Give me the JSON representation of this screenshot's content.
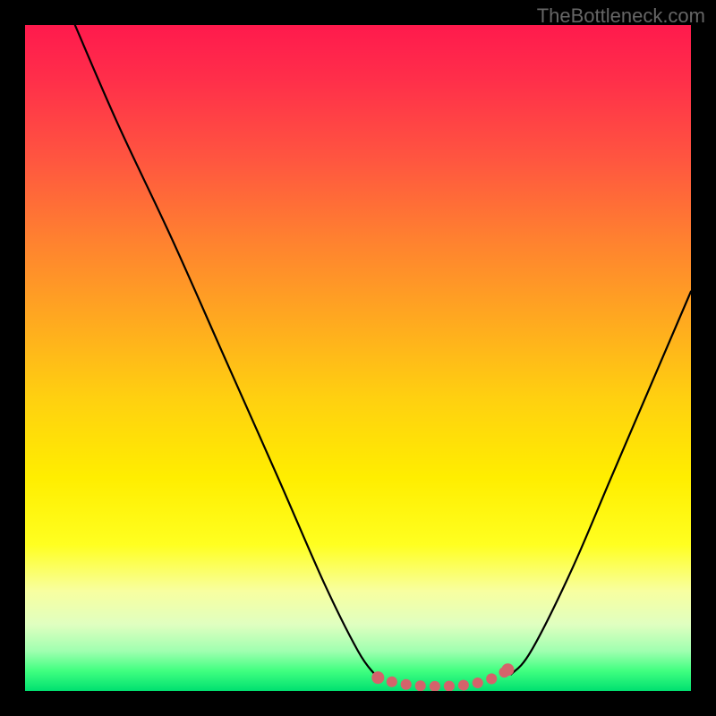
{
  "watermark": "TheBottleneck.com",
  "chart_data": {
    "type": "line",
    "title": "",
    "xlabel": "",
    "ylabel": "",
    "xlim": [
      0,
      100
    ],
    "ylim": [
      0,
      100
    ],
    "gradient_stops": [
      {
        "pos": 0,
        "color": "#ff1a4d"
      },
      {
        "pos": 8,
        "color": "#ff2e4a"
      },
      {
        "pos": 20,
        "color": "#ff5540"
      },
      {
        "pos": 32,
        "color": "#ff8030"
      },
      {
        "pos": 44,
        "color": "#ffa820"
      },
      {
        "pos": 56,
        "color": "#ffd010"
      },
      {
        "pos": 68,
        "color": "#ffee00"
      },
      {
        "pos": 78,
        "color": "#ffff20"
      },
      {
        "pos": 85,
        "color": "#f8ffa0"
      },
      {
        "pos": 90,
        "color": "#e0ffc0"
      },
      {
        "pos": 94,
        "color": "#a0ffb0"
      },
      {
        "pos": 97,
        "color": "#40ff80"
      },
      {
        "pos": 100,
        "color": "#00e070"
      }
    ],
    "series": [
      {
        "name": "left-curve",
        "type": "smooth-line",
        "color": "#000000",
        "stroke_width": 2.2,
        "points": [
          {
            "x": 7.5,
            "y": 100
          },
          {
            "x": 14,
            "y": 85
          },
          {
            "x": 22,
            "y": 68
          },
          {
            "x": 30,
            "y": 50
          },
          {
            "x": 38,
            "y": 32
          },
          {
            "x": 45,
            "y": 16
          },
          {
            "x": 50,
            "y": 6
          },
          {
            "x": 52.5,
            "y": 2.5
          }
        ]
      },
      {
        "name": "right-curve",
        "type": "smooth-line",
        "color": "#000000",
        "stroke_width": 2.2,
        "points": [
          {
            "x": 73,
            "y": 2.5
          },
          {
            "x": 76,
            "y": 6
          },
          {
            "x": 82,
            "y": 18
          },
          {
            "x": 88,
            "y": 32
          },
          {
            "x": 94,
            "y": 46
          },
          {
            "x": 100,
            "y": 60
          }
        ]
      },
      {
        "name": "bottom-dots",
        "type": "dotted-line",
        "color": "#d4636b",
        "dot_radius": 6,
        "stroke_width": 12,
        "points": [
          {
            "x": 53,
            "y": 2.0
          },
          {
            "x": 55,
            "y": 1.4
          },
          {
            "x": 57,
            "y": 1.0
          },
          {
            "x": 59,
            "y": 0.8
          },
          {
            "x": 61,
            "y": 0.7
          },
          {
            "x": 63,
            "y": 0.7
          },
          {
            "x": 65,
            "y": 0.8
          },
          {
            "x": 67,
            "y": 1.0
          },
          {
            "x": 69,
            "y": 1.5
          },
          {
            "x": 71,
            "y": 2.2
          },
          {
            "x": 72.5,
            "y": 3.2
          }
        ]
      }
    ]
  }
}
